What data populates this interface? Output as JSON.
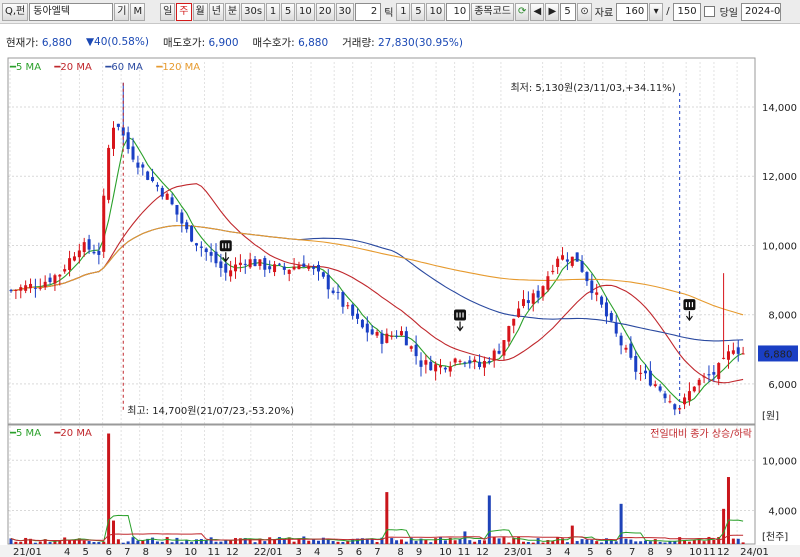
{
  "toolbar": {
    "search_label": "Q,펀",
    "stock_name": "동아엘텍",
    "btn_gi": "기",
    "btn_m": "M",
    "periods": [
      "일",
      "주",
      "월",
      "년",
      "분",
      "30s",
      "1",
      "5",
      "10",
      "20",
      "30"
    ],
    "active_period": "주",
    "tick_value": "2",
    "tick_label": "틱",
    "tick_opts": [
      "1",
      "5",
      "10"
    ],
    "tick_input": "10",
    "code_label": "종목코드",
    "step_value": "5",
    "data_label": "자료",
    "count_value": "160",
    "slash": "/",
    "total_value": "150",
    "today_label": "당일",
    "date_value": "2024-0"
  },
  "info": {
    "price_label": "현재가:",
    "price_value": "6,880",
    "change_value": "40(0.58%)",
    "ask_label": "매도호가:",
    "ask_value": "6,900",
    "bid_label": "매수호가:",
    "bid_value": "6,880",
    "vol_label": "거래량:",
    "vol_value": "27,830(30.95%)"
  },
  "chart_data": {
    "type": "candlestick",
    "price_legend": [
      {
        "name": "5 MA",
        "color": "#2aa02a"
      },
      {
        "name": "20 MA",
        "color": "#c0282d"
      },
      {
        "name": "60 MA",
        "color": "#2b4aa0"
      },
      {
        "name": "120 MA",
        "color": "#e69a2e"
      }
    ],
    "volume_legend": [
      {
        "name": "5 MA",
        "color": "#2aa02a"
      },
      {
        "name": "20 MA",
        "color": "#c0282d"
      }
    ],
    "volume_note": "전일대비 종가 상승/하락",
    "y_ticks": [
      "14,000",
      "12,000",
      "10,000",
      "8,000",
      "6,000"
    ],
    "y_unit": "[원]",
    "ylim": [
      4900,
      15300
    ],
    "vol_ticks": [
      "10,000",
      "4,000"
    ],
    "vol_unit": "[천주]",
    "vol_max": 13500,
    "current_price": "6,880",
    "high_annotation": "최고: 14,700원(21/07/23,-53.20%)",
    "low_annotation": "최저: 5,130원(23/11/03,+34.11%)",
    "x_ticks": [
      "21/01",
      "4",
      "5",
      "6",
      "7",
      "8",
      "9",
      "10",
      "11",
      "12",
      "22/01",
      "3",
      "4",
      "5",
      "6",
      "7",
      "8",
      "9",
      "10",
      "11",
      "12",
      "23/01",
      "3",
      "4",
      "5",
      "6",
      "7",
      "8",
      "9",
      "10",
      "11",
      "12",
      "24/01"
    ],
    "anchors": [
      [
        0,
        8700
      ],
      [
        6,
        8900
      ],
      [
        10,
        9200
      ],
      [
        14,
        10000
      ],
      [
        18,
        9800
      ],
      [
        20,
        12800
      ],
      [
        22,
        13500
      ],
      [
        24,
        12800
      ],
      [
        28,
        12000
      ],
      [
        32,
        11400
      ],
      [
        36,
        10400
      ],
      [
        40,
        9800
      ],
      [
        44,
        9200
      ],
      [
        48,
        9600
      ],
      [
        52,
        9400
      ],
      [
        56,
        9300
      ],
      [
        60,
        9500
      ],
      [
        64,
        9000
      ],
      [
        66,
        8700
      ],
      [
        68,
        8300
      ],
      [
        72,
        7600
      ],
      [
        76,
        7300
      ],
      [
        80,
        7500
      ],
      [
        84,
        6600
      ],
      [
        88,
        6500
      ],
      [
        92,
        6800
      ],
      [
        96,
        6500
      ],
      [
        100,
        7000
      ],
      [
        104,
        8200
      ],
      [
        108,
        8600
      ],
      [
        112,
        9700
      ],
      [
        116,
        9600
      ],
      [
        120,
        8500
      ],
      [
        124,
        7400
      ],
      [
        128,
        6400
      ],
      [
        132,
        6000
      ],
      [
        136,
        5400
      ],
      [
        138,
        5500
      ],
      [
        140,
        6000
      ],
      [
        144,
        6300
      ],
      [
        146,
        6600
      ],
      [
        148,
        7100
      ],
      [
        150,
        6880
      ]
    ]
  }
}
